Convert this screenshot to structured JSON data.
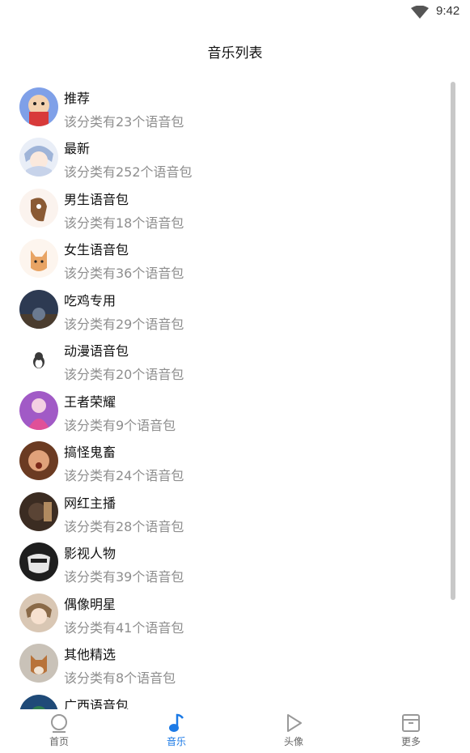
{
  "status": {
    "time": "9:42",
    "wifi_icon": "wifi-icon"
  },
  "header": {
    "title": "音乐列表"
  },
  "categories": [
    {
      "name": "推荐",
      "desc": "该分类有23个语音包",
      "avatar": "cartoon-boy-avatar"
    },
    {
      "name": "最新",
      "desc": "该分类有252个语音包",
      "avatar": "anime-girl-avatar"
    },
    {
      "name": "男生语音包",
      "desc": "该分类有18个语音包",
      "avatar": "cartoon-animal-avatar"
    },
    {
      "name": "女生语音包",
      "desc": "该分类有36个语音包",
      "avatar": "cartoon-fox-avatar"
    },
    {
      "name": "吃鸡专用",
      "desc": "该分类有29个语音包",
      "avatar": "game-scene-avatar"
    },
    {
      "name": "动漫语音包",
      "desc": "该分类有20个语音包",
      "avatar": "penguin-avatar"
    },
    {
      "name": "王者荣耀",
      "desc": "该分类有9个语音包",
      "avatar": "game-hero-avatar"
    },
    {
      "name": "搞怪鬼畜",
      "desc": "该分类有24个语音包",
      "avatar": "funny-face-avatar"
    },
    {
      "name": "网红主播",
      "desc": "该分类有28个语音包",
      "avatar": "streamer-avatar"
    },
    {
      "name": "影视人物",
      "desc": "该分类有39个语音包",
      "avatar": "movie-character-avatar"
    },
    {
      "name": "偶像明星",
      "desc": "该分类有41个语音包",
      "avatar": "idol-avatar"
    },
    {
      "name": "其他精选",
      "desc": "该分类有8个语音包",
      "avatar": "dog-avatar"
    },
    {
      "name": "广西语音包",
      "desc": "",
      "avatar": "landscape-avatar"
    }
  ],
  "tabs": [
    {
      "label": "首页",
      "icon": "home-circle-icon",
      "active": false
    },
    {
      "label": "音乐",
      "icon": "music-note-icon",
      "active": true
    },
    {
      "label": "头像",
      "icon": "play-triangle-icon",
      "active": false
    },
    {
      "label": "更多",
      "icon": "box-icon",
      "active": false
    }
  ],
  "colors": {
    "accent": "#1c7ae6",
    "text_secondary": "#8e8e8e",
    "scrollbar": "#c8c8c8"
  }
}
